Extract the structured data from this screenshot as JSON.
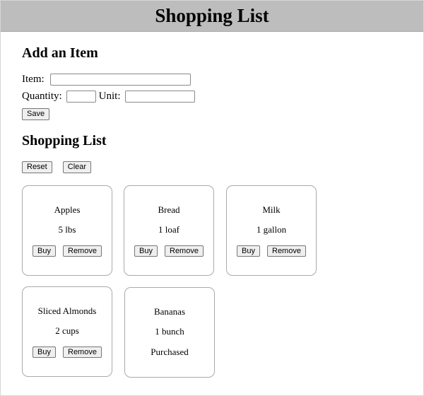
{
  "header": {
    "title": "Shopping List"
  },
  "add_form": {
    "title": "Add an Item",
    "item_label": "Item:",
    "item_value": "",
    "quantity_label": "Quantity:",
    "quantity_value": "",
    "unit_label": "Unit:",
    "unit_value": "",
    "save_label": "Save"
  },
  "list": {
    "title": "Shopping List",
    "reset_label": "Reset",
    "clear_label": "Clear",
    "buy_label": "Buy",
    "remove_label": "Remove",
    "items": [
      {
        "name": "Apples",
        "quantity": "5 lbs",
        "purchased": false
      },
      {
        "name": "Bread",
        "quantity": "1 loaf",
        "purchased": false
      },
      {
        "name": "Milk",
        "quantity": "1 gallon",
        "purchased": false
      },
      {
        "name": "Sliced Almonds",
        "quantity": "2 cups",
        "purchased": false
      },
      {
        "name": "Bananas",
        "quantity": "1 bunch",
        "purchased": true,
        "status": "Purchased"
      }
    ]
  }
}
